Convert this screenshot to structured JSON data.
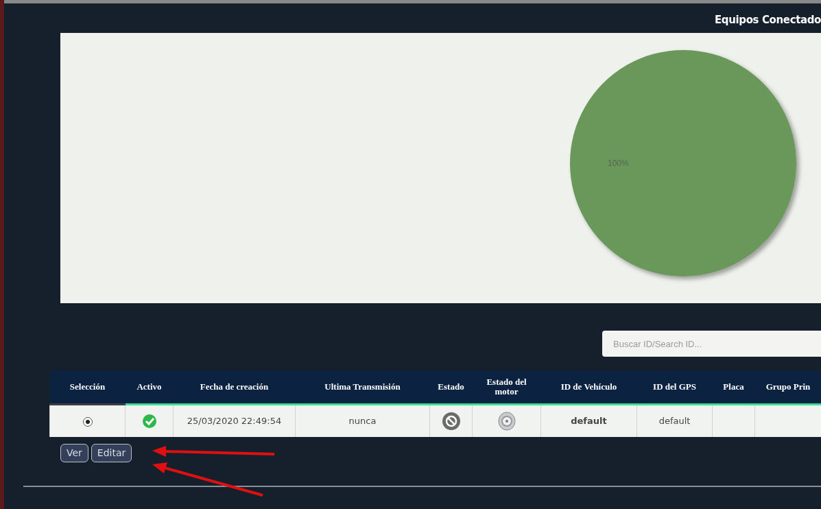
{
  "header": {
    "title": "Equipos Conectado"
  },
  "chart": {
    "chart_data": {
      "type": "pie",
      "values": [
        100
      ],
      "value_labels": [
        "100%"
      ]
    }
  },
  "search": {
    "placeholder": "Buscar ID/Search ID..."
  },
  "table": {
    "columns": [
      "Selección",
      "Activo",
      "Fecha de creación",
      "Ultima Transmisión",
      "Estado",
      "Estado del motor",
      "ID de Vehículo",
      "ID del GPS",
      "Placa",
      "Grupo Prin"
    ],
    "rows": [
      {
        "selected": true,
        "active": true,
        "created": "25/03/2020 22:49:54",
        "last_transmission": "nunca",
        "blocked": true,
        "engine_on": false,
        "vehicle_id": "default",
        "gps_id": "default"
      }
    ]
  },
  "buttons": [
    "Ver",
    "Editar"
  ]
}
